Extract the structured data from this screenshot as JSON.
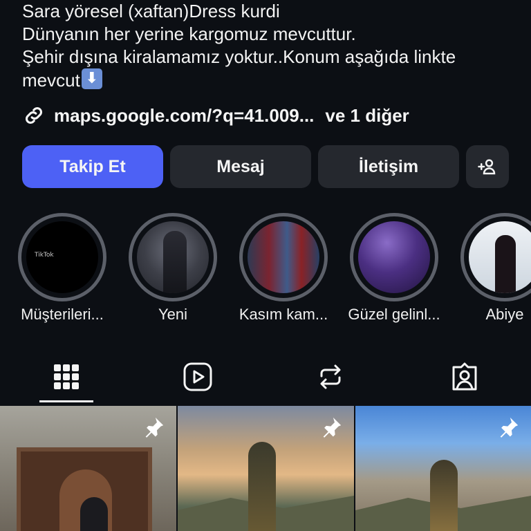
{
  "bio": {
    "line1": "Sara yöresel (xaftan)Dress kurdi",
    "line2": "Dünyanın her yerine kargomuz mevcuttur.",
    "line3": "Şehir dışına kiralamamız yoktur..Konum aşağıda linkte",
    "line4": "mevcut"
  },
  "link": {
    "url": "maps.google.com/?q=41.009...",
    "more": "ve 1 diğer",
    "icon": "link-icon"
  },
  "buttons": {
    "follow": "Takip Et",
    "message": "Mesaj",
    "contact": "İletişim",
    "add_user_icon": "add-user-icon"
  },
  "colors": {
    "background": "#0c0f14",
    "primary_button": "#4d61f5",
    "secondary_button": "#25282e",
    "story_ring": "#5c6069"
  },
  "highlights": [
    {
      "label": "Müşterileri...",
      "thumb_text": "TikTok"
    },
    {
      "label": "Yeni"
    },
    {
      "label": "Kasım kam..."
    },
    {
      "label": "Güzel gelinl..."
    },
    {
      "label": "Abiye"
    }
  ],
  "tabs": [
    {
      "name": "grid",
      "icon": "grid-icon",
      "active": true
    },
    {
      "name": "reels",
      "icon": "reels-icon"
    },
    {
      "name": "reposts",
      "icon": "repost-icon"
    },
    {
      "name": "tagged",
      "icon": "tagged-icon"
    }
  ],
  "posts": [
    {
      "pinned": true,
      "icon": "pin-icon"
    },
    {
      "pinned": true,
      "icon": "pin-icon"
    },
    {
      "pinned": true,
      "icon": "pin-icon"
    }
  ]
}
